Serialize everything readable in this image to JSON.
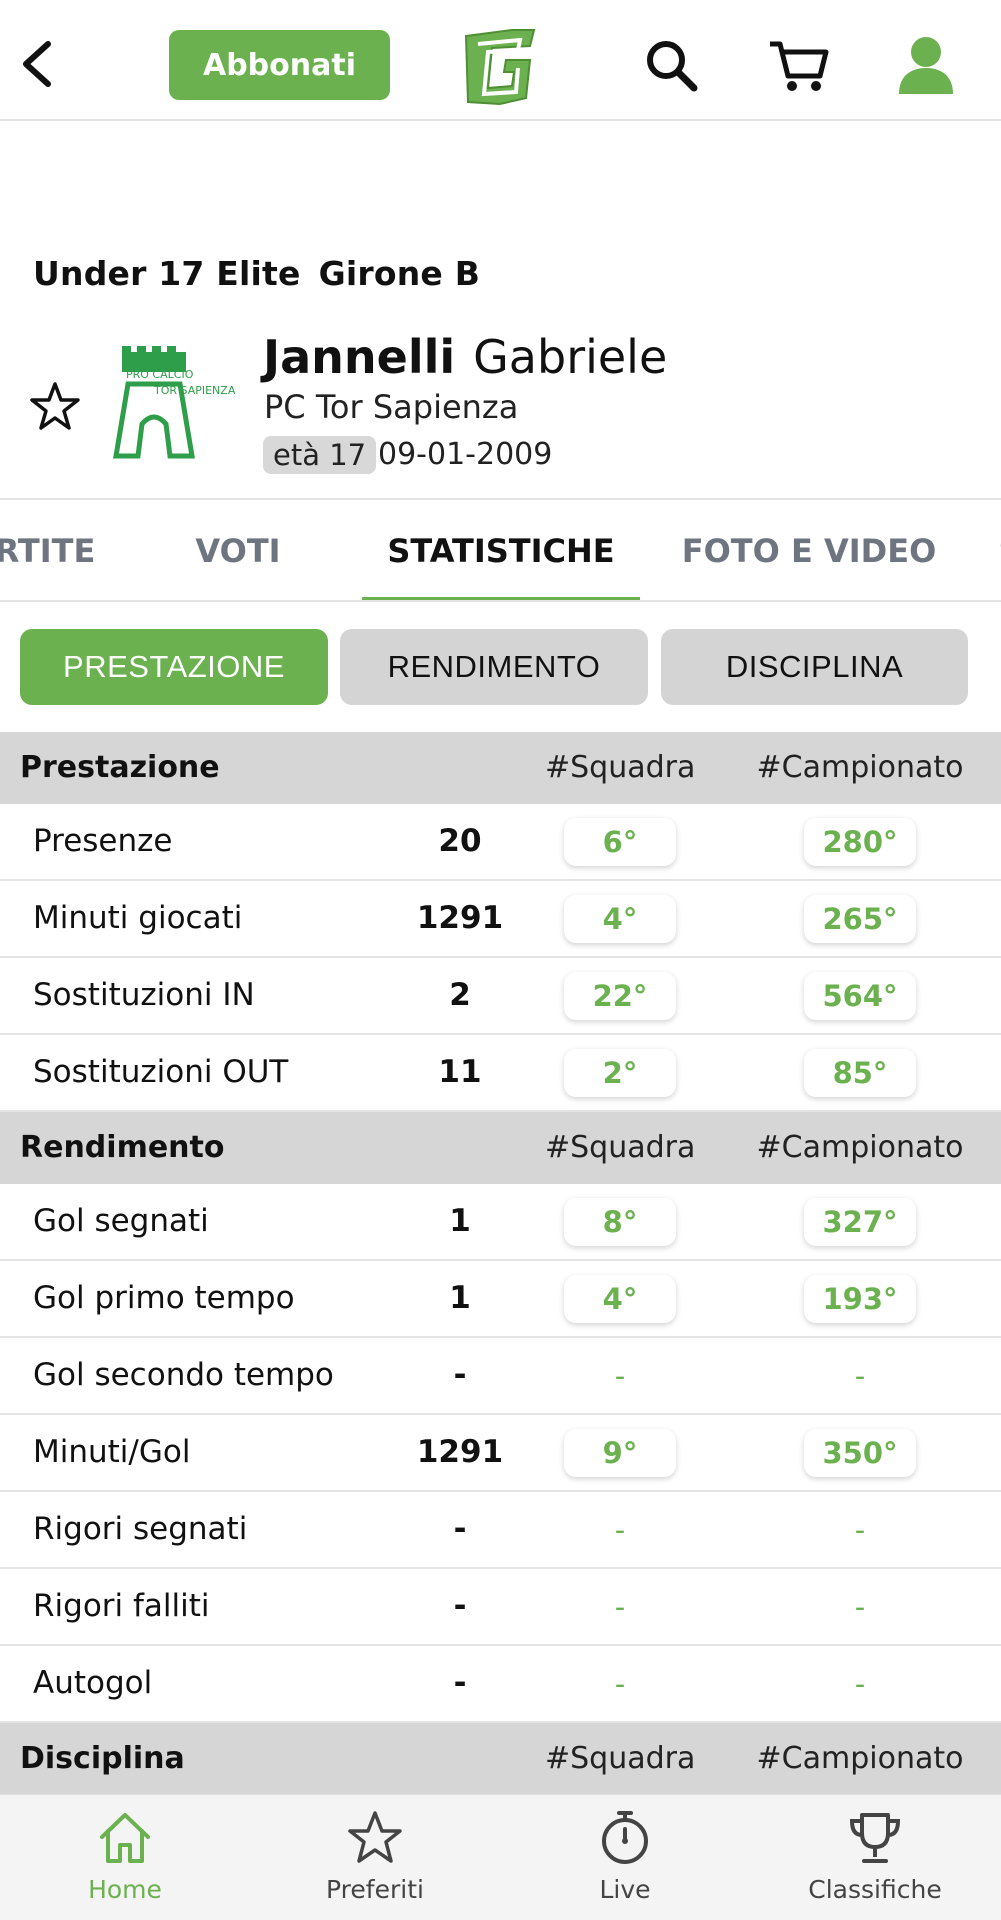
{
  "header": {
    "subscribe_label": "Abbonati",
    "logo_letter": "G",
    "brand_color": "#6cb14f",
    "icons": [
      "back-icon",
      "search-icon",
      "cart-icon",
      "user-icon"
    ]
  },
  "league": {
    "name": "Under 17 Elite",
    "group": "Girone B"
  },
  "player": {
    "last_name": "Jannelli",
    "first_name": "Gabriele",
    "club": "PC Tor Sapienza",
    "age_label": "età 17",
    "birth_date": "09-01-2009",
    "club_logo_text_1": "PRO CALCIO",
    "club_logo_text_2": "TOR SAPIENZA"
  },
  "tabs": [
    "RTITE",
    "VOTI",
    "STATISTICHE",
    "FOTO E VIDEO",
    "S"
  ],
  "active_tab": "STATISTICHE",
  "segments": [
    "PRESTAZIONE",
    "RENDIMENTO",
    "DISCIPLINA"
  ],
  "active_segment": "PRESTAZIONE",
  "stats": {
    "sections": [
      {
        "title": "Prestazione",
        "col_team": "#Squadra",
        "col_league": "#Campionato",
        "rows": [
          {
            "label": "Presenze",
            "value": "20",
            "team_rank": "6°",
            "league_rank": "280°"
          },
          {
            "label": "Minuti giocati",
            "value": "1291",
            "team_rank": "4°",
            "league_rank": "265°"
          },
          {
            "label": "Sostituzioni IN",
            "value": "2",
            "team_rank": "22°",
            "league_rank": "564°"
          },
          {
            "label": "Sostituzioni OUT",
            "value": "11",
            "team_rank": "2°",
            "league_rank": "85°"
          }
        ]
      },
      {
        "title": "Rendimento",
        "col_team": "#Squadra",
        "col_league": "#Campionato",
        "rows": [
          {
            "label": "Gol segnati",
            "value": "1",
            "team_rank": "8°",
            "league_rank": "327°"
          },
          {
            "label": "Gol primo tempo",
            "value": "1",
            "team_rank": "4°",
            "league_rank": "193°"
          },
          {
            "label": "Gol secondo tempo",
            "value": "-",
            "team_rank": "-",
            "league_rank": "-"
          },
          {
            "label": "Minuti/Gol",
            "value": "1291",
            "team_rank": "9°",
            "league_rank": "350°"
          },
          {
            "label": "Rigori segnati",
            "value": "-",
            "team_rank": "-",
            "league_rank": "-"
          },
          {
            "label": "Rigori falliti",
            "value": "-",
            "team_rank": "-",
            "league_rank": "-"
          },
          {
            "label": "Autogol",
            "value": "-",
            "team_rank": "-",
            "league_rank": "-"
          }
        ]
      },
      {
        "title": "Disciplina",
        "col_team": "#Squadra",
        "col_league": "#Campionato",
        "rows": []
      }
    ]
  },
  "bottom_nav": {
    "items": [
      {
        "label": "Home",
        "icon": "home-icon"
      },
      {
        "label": "Preferiti",
        "icon": "star-icon"
      },
      {
        "label": "Live",
        "icon": "stopwatch-icon"
      },
      {
        "label": "Classifiche",
        "icon": "trophy-icon"
      }
    ],
    "active": "Home"
  }
}
